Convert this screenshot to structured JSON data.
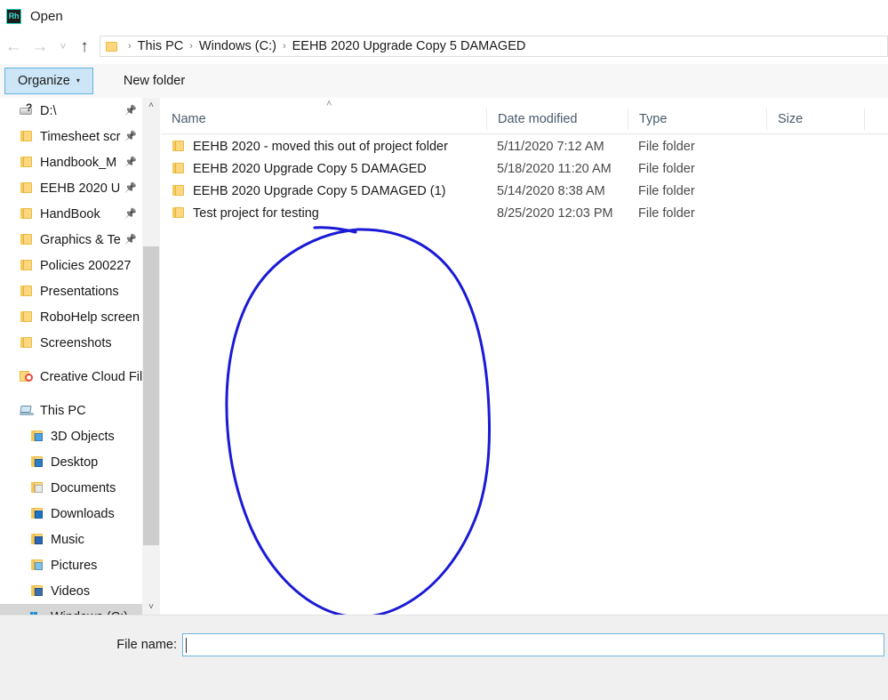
{
  "window": {
    "app_icon": "rhino-icon",
    "app_icon_text": "Rh",
    "title": "Open"
  },
  "navigation": {
    "back_icon": "←",
    "forward_icon": "→",
    "recent_icon": "˅",
    "up_icon": "↑",
    "breadcrumb": {
      "folder_icon": "folder-icon",
      "separator": "›",
      "items": [
        {
          "label": "This PC"
        },
        {
          "label": "Windows (C:)"
        },
        {
          "label": "EEHB 2020 Upgrade Copy 5 DAMAGED"
        }
      ]
    }
  },
  "toolbar": {
    "organize_label": "Organize",
    "organize_caret": "▾",
    "new_folder_label": "New folder"
  },
  "sidebar": {
    "scroll_up_icon": "˄",
    "scroll_down_icon": "˅",
    "pin_icon": "📌",
    "items": [
      {
        "label": "D:\\",
        "icon": "drive-question-icon",
        "pinned": true,
        "level": 1,
        "selected": false
      },
      {
        "label": "Timesheet scr",
        "icon": "folder-icon",
        "pinned": true,
        "level": 1,
        "selected": false
      },
      {
        "label": "Handbook_M",
        "icon": "folder-icon",
        "pinned": true,
        "level": 1,
        "selected": false
      },
      {
        "label": "EEHB 2020 U",
        "icon": "folder-icon",
        "pinned": true,
        "level": 1,
        "selected": false
      },
      {
        "label": "HandBook",
        "icon": "folder-icon",
        "pinned": true,
        "level": 1,
        "selected": false
      },
      {
        "label": "Graphics & Te",
        "icon": "folder-icon",
        "pinned": true,
        "level": 1,
        "selected": false
      },
      {
        "label": "Policies 200227",
        "icon": "folder-icon",
        "pinned": false,
        "level": 1,
        "selected": false
      },
      {
        "label": "Presentations",
        "icon": "folder-icon",
        "pinned": false,
        "level": 1,
        "selected": false
      },
      {
        "label": "RoboHelp screen",
        "icon": "folder-icon",
        "pinned": false,
        "level": 1,
        "selected": false
      },
      {
        "label": "Screenshots",
        "icon": "folder-icon",
        "pinned": false,
        "level": 1,
        "selected": false
      },
      {
        "label": "",
        "icon": "spacer",
        "pinned": false,
        "level": 1,
        "selected": false
      },
      {
        "label": "Creative Cloud File",
        "icon": "creative-cloud-icon",
        "pinned": false,
        "level": 1,
        "selected": false
      },
      {
        "label": "",
        "icon": "spacer",
        "pinned": false,
        "level": 1,
        "selected": false
      },
      {
        "label": "This PC",
        "icon": "this-pc-icon",
        "pinned": false,
        "level": 1,
        "selected": false
      },
      {
        "label": "3D Objects",
        "icon": "folder-3d-icon",
        "pinned": false,
        "level": 2,
        "selected": false
      },
      {
        "label": "Desktop",
        "icon": "folder-desktop-icon",
        "pinned": false,
        "level": 2,
        "selected": false
      },
      {
        "label": "Documents",
        "icon": "folder-documents-icon",
        "pinned": false,
        "level": 2,
        "selected": false
      },
      {
        "label": "Downloads",
        "icon": "folder-downloads-icon",
        "pinned": false,
        "level": 2,
        "selected": false
      },
      {
        "label": "Music",
        "icon": "folder-music-icon",
        "pinned": false,
        "level": 2,
        "selected": false
      },
      {
        "label": "Pictures",
        "icon": "folder-pictures-icon",
        "pinned": false,
        "level": 2,
        "selected": false
      },
      {
        "label": "Videos",
        "icon": "folder-videos-icon",
        "pinned": false,
        "level": 2,
        "selected": false
      },
      {
        "label": "Windows (C:)",
        "icon": "windows-drive-icon",
        "pinned": false,
        "level": 2,
        "selected": true
      }
    ]
  },
  "file_list": {
    "sort_indicator_icon": "˄",
    "columns": [
      {
        "key": "name",
        "label": "Name"
      },
      {
        "key": "date",
        "label": "Date modified"
      },
      {
        "key": "type",
        "label": "Type"
      },
      {
        "key": "size",
        "label": "Size"
      }
    ],
    "rows": [
      {
        "icon": "folder-icon",
        "name": "EEHB 2020 - moved this out of project folder",
        "date": "5/11/2020 7:12 AM",
        "type": "File folder",
        "size": ""
      },
      {
        "icon": "folder-icon",
        "name": "EEHB 2020 Upgrade Copy 5 DAMAGED",
        "date": "5/18/2020 11:20 AM",
        "type": "File folder",
        "size": ""
      },
      {
        "icon": "folder-icon",
        "name": "EEHB 2020 Upgrade Copy 5 DAMAGED (1)",
        "date": "5/14/2020 8:38 AM",
        "type": "File folder",
        "size": ""
      },
      {
        "icon": "folder-icon",
        "name": "Test project for testing",
        "date": "8/25/2020 12:03 PM",
        "type": "File folder",
        "size": ""
      }
    ]
  },
  "annotation": {
    "shape": "hand-drawn-ellipse",
    "color": "#1a1ad6",
    "stroke_width": 3
  },
  "footer": {
    "filename_label": "File name:",
    "filename_value": "",
    "filename_placeholder": ""
  },
  "colors": {
    "accent_blue": "#0078d7",
    "ink_blue": "#1a1ad6",
    "folder_yellow": "#fcd77f",
    "selection_gray": "#d6d6d6",
    "panel_gray": "#f0f0f0"
  }
}
